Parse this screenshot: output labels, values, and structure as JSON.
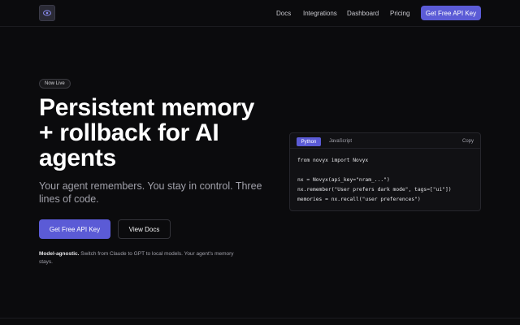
{
  "header": {
    "logo_icon": "novyx-logo-icon",
    "nav": [
      {
        "label": "Docs"
      },
      {
        "label": "Integrations"
      },
      {
        "label": "Dashboard"
      },
      {
        "label": "Pricing"
      }
    ],
    "cta_label": "Get Free API Key"
  },
  "hero": {
    "badge": "Now Live",
    "title_lines": [
      "Persistent memory",
      "+ rollback for AI",
      "agents"
    ],
    "subtitle_lines": [
      "Your agent remembers. You stay in control. Three",
      "lines of code."
    ],
    "primary_button": "Get Free API Key",
    "secondary_button": "View Docs",
    "footnote_bold": "Model-agnostic.",
    "footnote_rest_1": " Switch from Claude to GPT to local models. Your agent's memory",
    "footnote_rest_2": "stays."
  },
  "code_card": {
    "tabs": [
      {
        "label": "Python",
        "active": true
      },
      {
        "label": "JavaScript",
        "active": false
      }
    ],
    "copy_label": "Copy",
    "lines": [
      "from novyx import Novyx",
      "",
      "nx = Novyx(api_key=\"nram_...\")",
      "nx.remember(\"User prefers dark mode\", tags=[\"ui\"])",
      "memories = nx.recall(\"user preferences\")"
    ]
  },
  "colors": {
    "accent": "#5b5bd6",
    "background": "#0b0b0d",
    "muted_text": "#a1a1aa"
  }
}
